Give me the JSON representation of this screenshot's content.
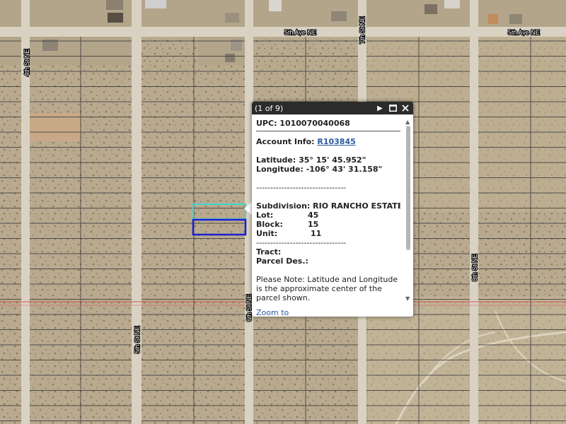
{
  "streets": {
    "ave_5th_a": "5th Ave NE",
    "ave_5th_b": "5th Ave NE",
    "st_4th": "4th St NE",
    "st_5th": "5th St NE",
    "st_6th": "6th St NE",
    "st_7th": "7th St NE",
    "st_8th": "8th St NE"
  },
  "popup": {
    "count": "(1 of 9)",
    "upc": "UPC: 1010070040068",
    "account_label": "Account Info:",
    "account_value": "R103845",
    "latitude": "Latitude: 35° 15' 45.952\"",
    "longitude": "Longitude: -106° 43' 31.158\"",
    "divider": "--------------------------------",
    "subdivision": "Subdivision: RIO RANCHO ESTATES",
    "lot_label": "Lot:",
    "lot_value": "45",
    "block_label": "Block:",
    "block_value": "15",
    "unit_label": "Unit:",
    "unit_value": "11",
    "tract": "Tract:",
    "parcel_des": "Parcel Des.:",
    "note": "Please Note: Latitude and Longitude is the approximate center of the parcel shown.",
    "zoom_to": "Zoom to"
  },
  "colors": {
    "highlight_cyan": "#3fd6d0",
    "highlight_blue": "#1b1fd0",
    "boundary_red": "#d23a3a"
  },
  "icons": {
    "next": "play-icon",
    "maximize": "maximize-icon",
    "close": "close-icon"
  }
}
